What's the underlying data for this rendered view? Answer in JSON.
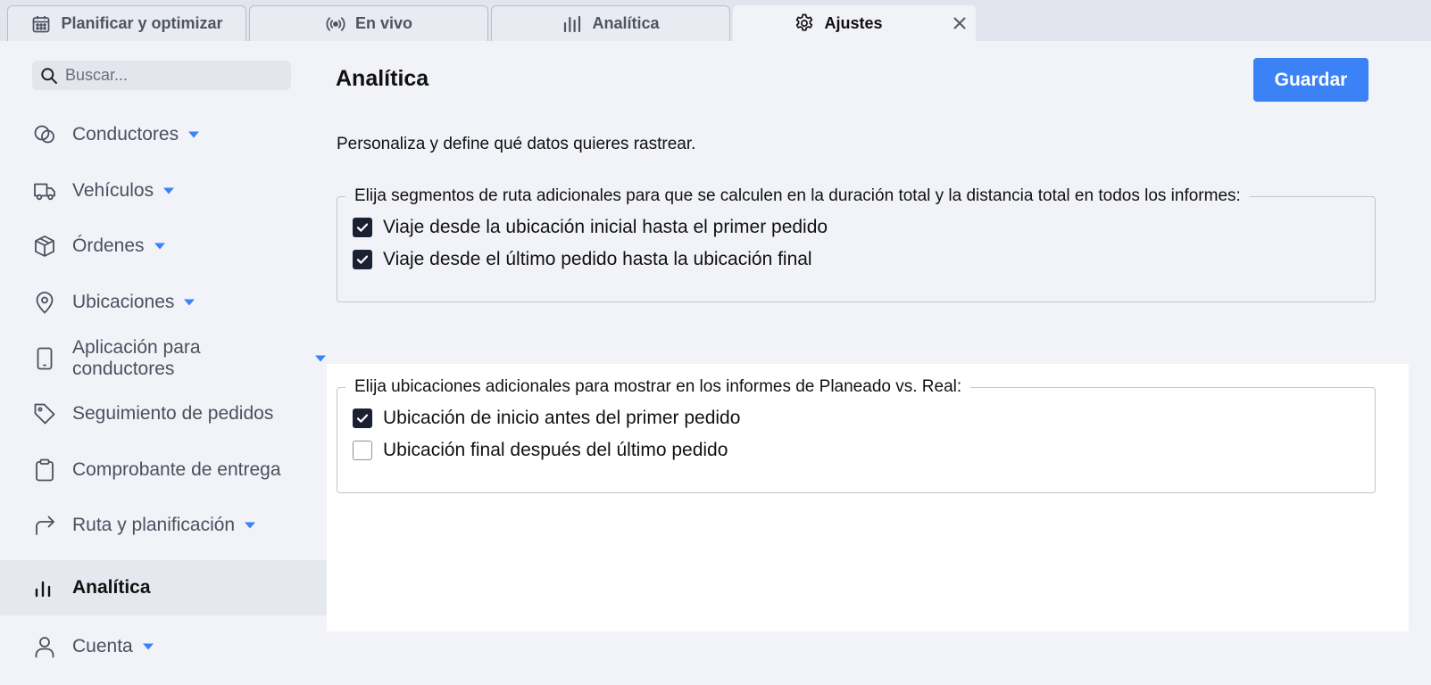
{
  "tabs": [
    {
      "label": "Planificar y optimizar",
      "icon": "calendar-icon"
    },
    {
      "label": "En vivo",
      "icon": "broadcast-icon"
    },
    {
      "label": "Analítica",
      "icon": "bar-chart-icon"
    },
    {
      "label": "Ajustes",
      "icon": "gear-icon",
      "active": true,
      "closable": true
    }
  ],
  "sidebar": {
    "search_placeholder": "Buscar...",
    "items": [
      {
        "label": "Conductores",
        "icon": "drivers-icon",
        "has_dropdown": true
      },
      {
        "label": "Vehículos",
        "icon": "truck-icon",
        "has_dropdown": true
      },
      {
        "label": "Órdenes",
        "icon": "package-icon",
        "has_dropdown": true
      },
      {
        "label": "Ubicaciones",
        "icon": "map-pin-icon",
        "has_dropdown": true
      },
      {
        "label": "Aplicación para conductores",
        "icon": "phone-icon",
        "has_dropdown": true
      },
      {
        "label": "Seguimiento de pedidos",
        "icon": "tag-icon",
        "has_dropdown": false
      },
      {
        "label": "Comprobante de entrega",
        "icon": "clipboard-icon",
        "has_dropdown": false
      },
      {
        "label": "Ruta y planificación",
        "icon": "route-arrow-icon",
        "has_dropdown": true
      },
      {
        "label": "Analítica",
        "icon": "bar-chart-icon",
        "has_dropdown": false,
        "active": true
      },
      {
        "label": "Cuenta",
        "icon": "user-icon",
        "has_dropdown": true
      }
    ]
  },
  "main": {
    "title": "Analítica",
    "save_label": "Guardar",
    "description": "Personaliza y define qué datos quieres rastrear.",
    "groups": [
      {
        "legend": "Elija segmentos de ruta adicionales para que se calculen en la duración total y la distancia total en todos los informes:",
        "options": [
          {
            "label": "Viaje desde la ubicación inicial hasta el primer pedido",
            "checked": true
          },
          {
            "label": "Viaje desde el último pedido hasta la ubicación final",
            "checked": true
          }
        ]
      },
      {
        "legend": "Elija ubicaciones adicionales para mostrar en los informes de Planeado vs. Real:",
        "options": [
          {
            "label": "Ubicación de inicio antes del primer pedido",
            "checked": true
          },
          {
            "label": "Ubicación final después del último pedido",
            "checked": false
          }
        ]
      }
    ]
  },
  "colors": {
    "accent": "#3b82f6",
    "checkbox_checked": "#1b2032",
    "background": "#f2f3f8"
  }
}
